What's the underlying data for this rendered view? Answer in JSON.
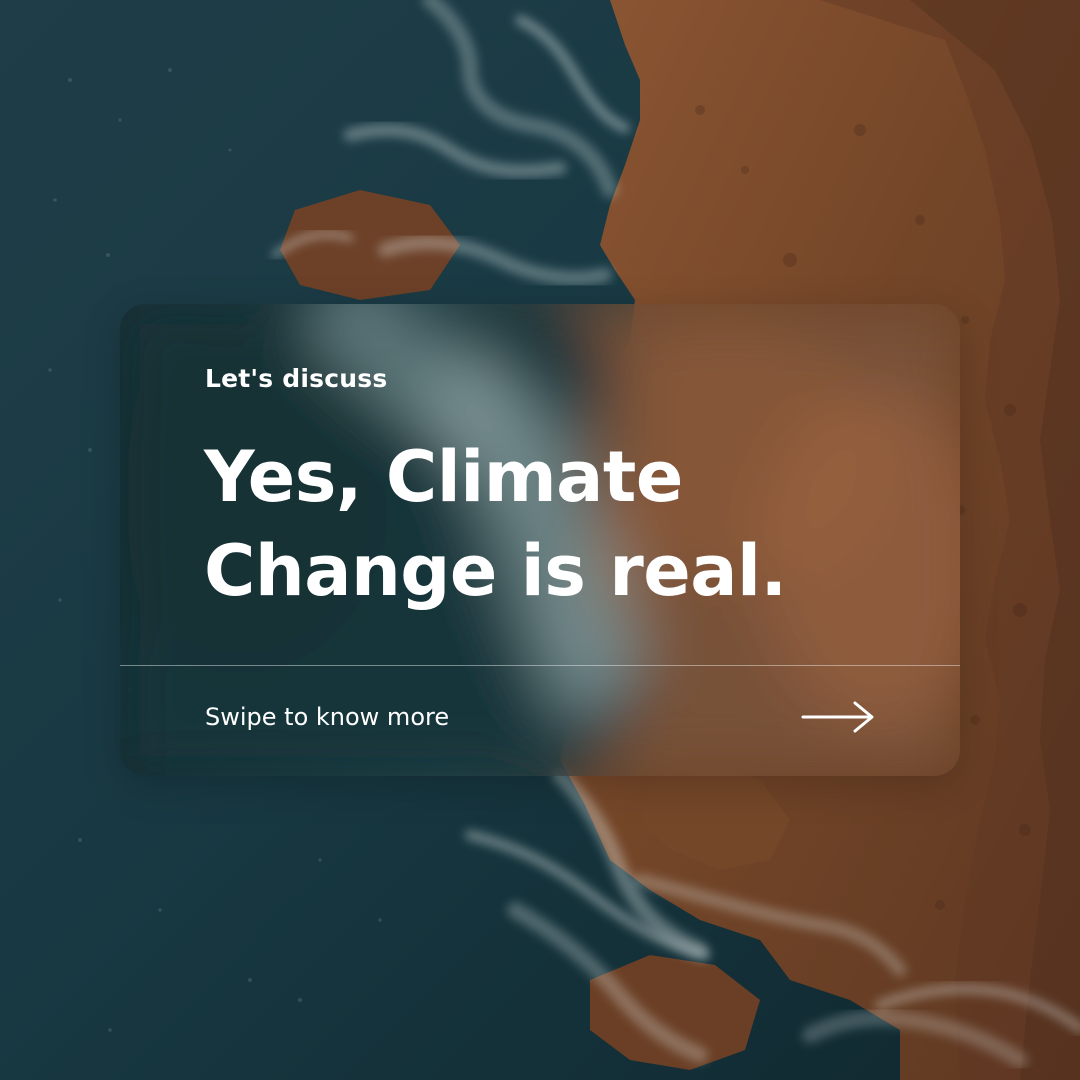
{
  "card": {
    "eyebrow": "Let's discuss",
    "headline": "Yes, Climate Change is real.",
    "footer": "Swipe to know more"
  },
  "icons": {
    "arrow": "arrow-right-icon"
  },
  "colors": {
    "text": "#ffffff",
    "ocean": "#173640",
    "rock": "#8a5432",
    "foam": "#e6f0ee"
  }
}
